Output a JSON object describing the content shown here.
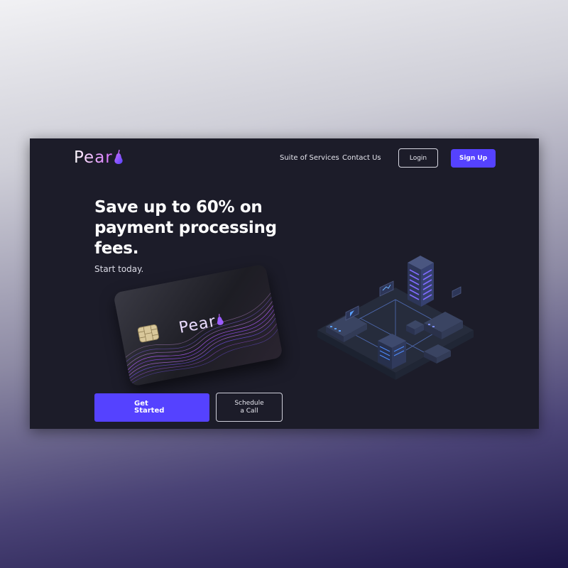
{
  "brand": {
    "name": "Pear"
  },
  "nav": {
    "links": [
      "Suite of Services",
      "Contact Us"
    ],
    "login_label": "Login",
    "signup_label": "Sign Up"
  },
  "hero": {
    "headline": "Save up to 60% on payment processing fees.",
    "subtext": "Start today.",
    "primary_cta": [
      "Get",
      "Started"
    ],
    "secondary_cta": [
      "Schedule",
      "a Call"
    ]
  },
  "card": {
    "logo_text": "Pear"
  },
  "colors": {
    "accent": "#5542ff",
    "frame_bg": "#1c1c29",
    "logo_gradient_end": "#d469ff"
  }
}
